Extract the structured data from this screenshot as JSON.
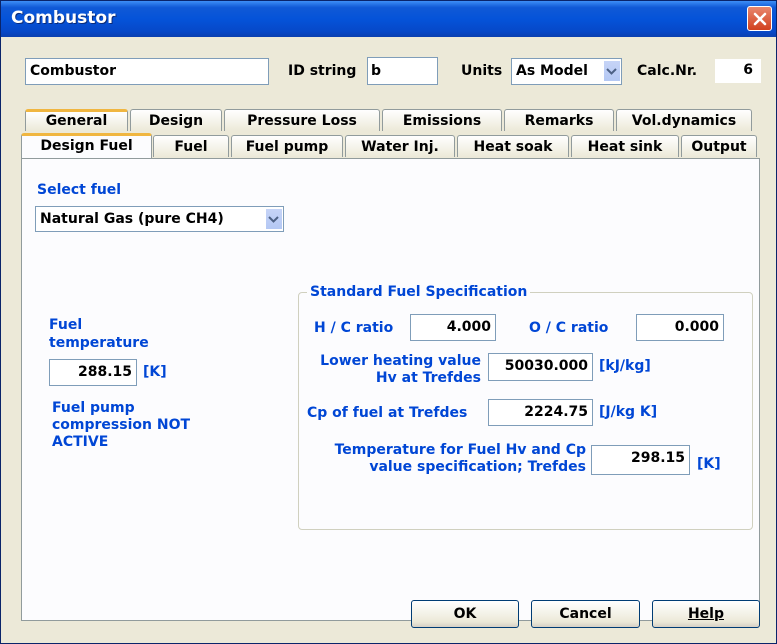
{
  "window": {
    "title": "Combustor"
  },
  "header": {
    "name_value": "Combustor",
    "id_label": "ID string",
    "id_value": "b",
    "units_label": "Units",
    "units_value": "As Model",
    "calc_label": "Calc.Nr.",
    "calc_value": "6"
  },
  "tabs_row1": [
    "General",
    "Design",
    "Pressure Loss",
    "Emissions",
    "Remarks",
    "Vol.dynamics"
  ],
  "tabs_row2": [
    "Design Fuel",
    "Fuel",
    "Fuel pump",
    "Water Inj.",
    "Heat soak",
    "Heat sink",
    "Output"
  ],
  "active_tab": "Design Fuel",
  "select_fuel": {
    "label": "Select fuel",
    "value": "Natural Gas (pure CH4)"
  },
  "fuel_temperature": {
    "label_line1": "Fuel",
    "label_line2": "temperature",
    "value": "288.15",
    "unit": "[K]",
    "note_line1": "Fuel pump",
    "note_line2": "compression  NOT",
    "note_line3": "ACTIVE"
  },
  "spec": {
    "title": "Standard Fuel Specification",
    "hc_label": "H / C ratio",
    "hc_value": "4.000",
    "oc_label": "O / C ratio",
    "oc_value": "0.000",
    "lhv_label_line1": "Lower heating value",
    "lhv_label_line2": "Hv at Trefdes",
    "lhv_value": "50030.000",
    "lhv_unit": "[kJ/kg]",
    "cp_label": "Cp of fuel at Trefdes",
    "cp_value": "2224.75",
    "cp_unit": "[J/kg K]",
    "tref_label_line1": "Temperature for Fuel Hv and Cp",
    "tref_label_line2": "value specification; Trefdes",
    "tref_value": "298.15",
    "tref_unit": "[K]"
  },
  "buttons": {
    "ok": "OK",
    "cancel": "Cancel",
    "help": "Help"
  }
}
